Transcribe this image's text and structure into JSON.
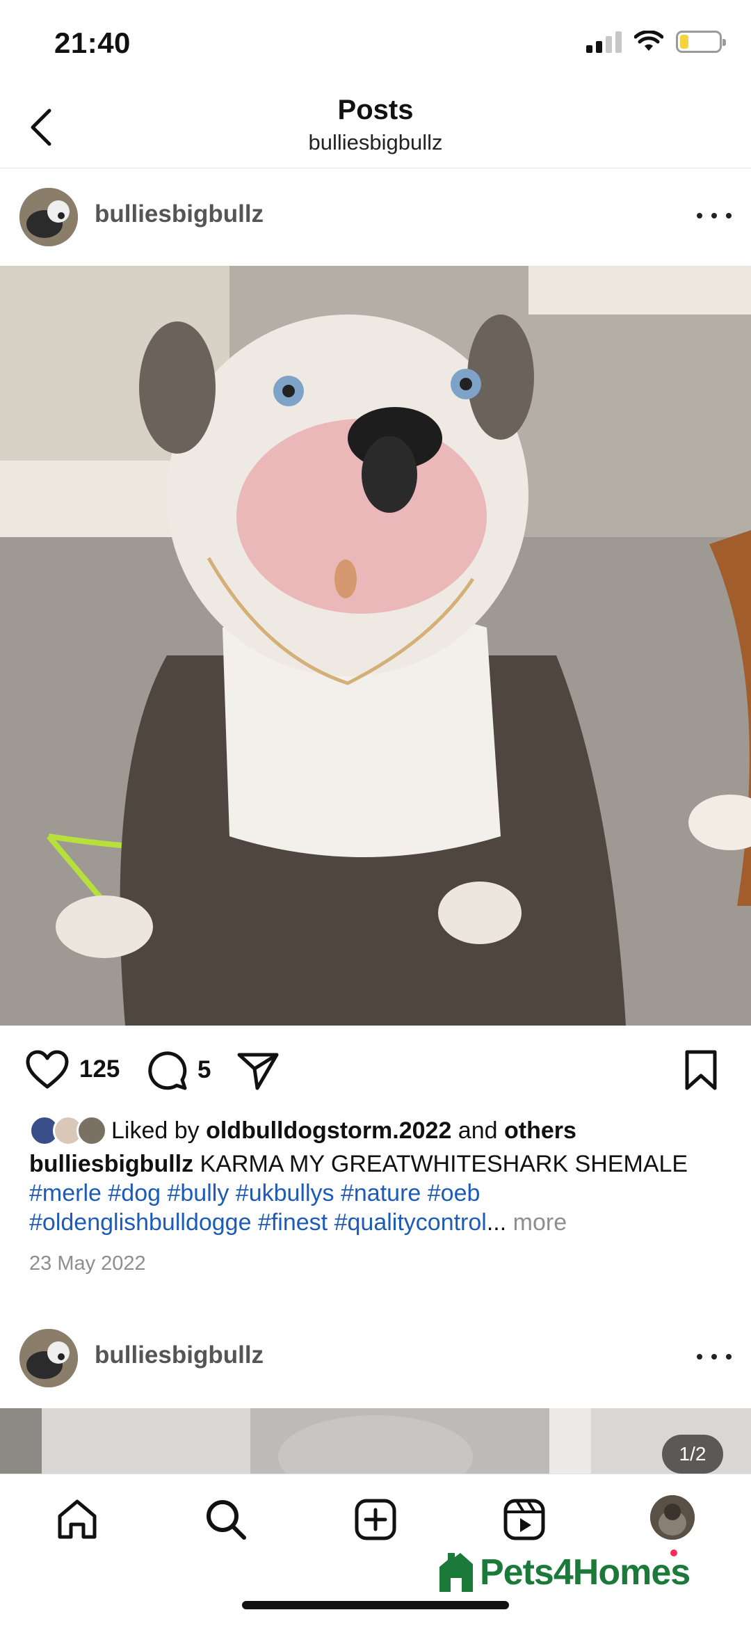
{
  "status_bar": {
    "time": "21:40"
  },
  "header": {
    "title": "Posts",
    "subtitle": "bulliesbigbullz"
  },
  "post1": {
    "username": "bulliesbigbullz",
    "like_count": "125",
    "comment_count": "5",
    "liked_by_prefix": "Liked by ",
    "liked_by_user": "oldbulldogstorm.2022",
    "liked_by_mid": " and ",
    "liked_by_others": "others",
    "caption_user": "bulliesbigbullz",
    "caption_text": " KARMA MY GREATWHITESHARK SHEMALE",
    "hashtags_line1": [
      "#merle",
      "#dog",
      "#bully",
      "#ukbullys",
      "#nature",
      "#oeb"
    ],
    "hashtags_line2": [
      "#oldenglishbulldogge",
      "#finest",
      "#qualitycontrol"
    ],
    "ellipsis": "...",
    "more": "more",
    "date": "23 May 2022"
  },
  "post2": {
    "username": "bulliesbigbullz",
    "page_indicator": "1/2"
  },
  "tab_bar": {
    "items": [
      "home-icon",
      "search-icon",
      "create-icon",
      "reels-icon",
      "profile-avatar"
    ]
  },
  "watermark": {
    "text": "Pets4Homes",
    "color": "#1b7a3a"
  },
  "colors": {
    "hashtag": "#1d5bb8",
    "muted": "#8e8e8e",
    "notification": "#ff2d55"
  }
}
